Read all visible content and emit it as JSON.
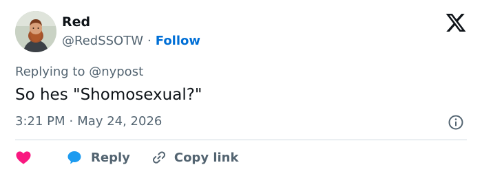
{
  "author": {
    "name": "Red",
    "handle": "@RedSSOTW",
    "separator": "·",
    "follow_label": "Follow",
    "avatar_icon": "bearded-man-avatar"
  },
  "tweet": {
    "replying_to": "Replying to @nypost",
    "text": "So hes \"Shomosexual?\"",
    "time": "3:21 PM",
    "separator": "·",
    "date": "May 24, 2026"
  },
  "actions": {
    "like_icon": "heart-icon",
    "reply_label": "Reply",
    "copy_link_label": "Copy link"
  },
  "colors": {
    "like": "#f91880",
    "reply": "#1d9bf0",
    "follow": "#006fd6",
    "muted": "#536471",
    "text": "#0f1419"
  }
}
